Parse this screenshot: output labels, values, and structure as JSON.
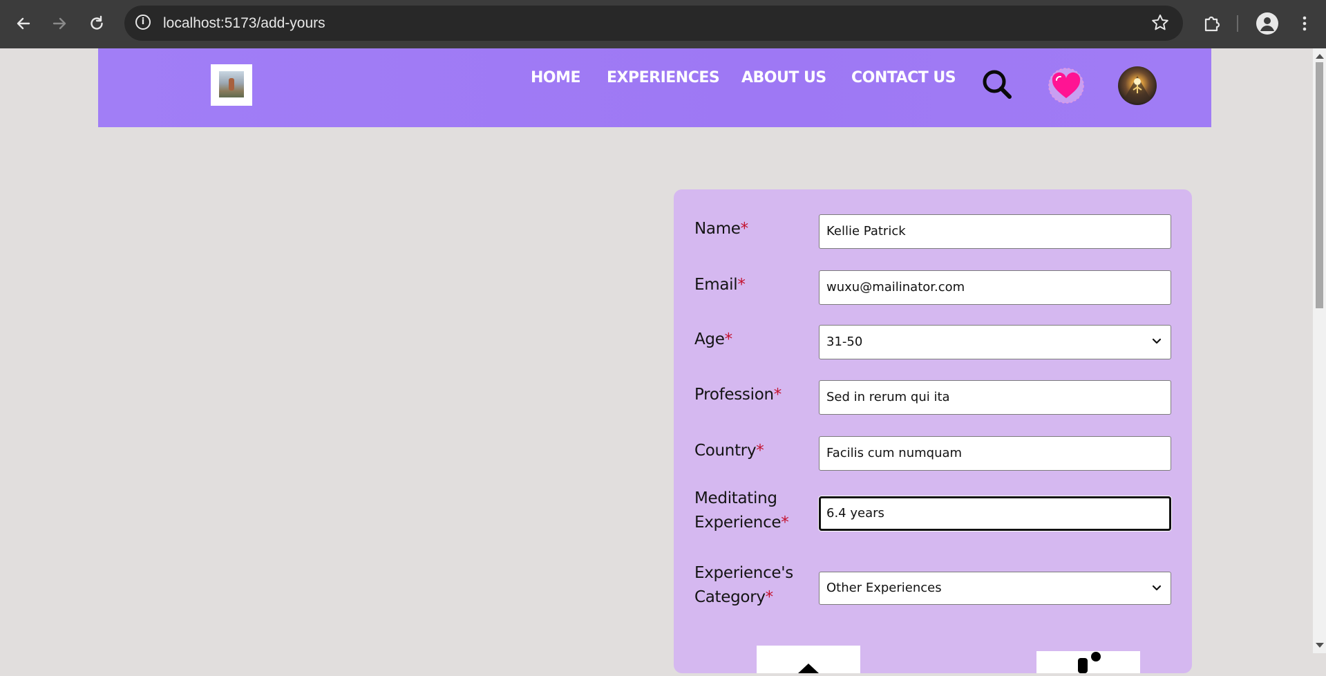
{
  "browser": {
    "url": "localhost:5173/add-yours",
    "icons": {
      "back": "arrow-left-icon",
      "forward": "arrow-right-icon",
      "reload": "reload-icon",
      "site_info": "info-icon",
      "bookmark": "star-icon",
      "extensions": "puzzle-icon",
      "profile": "person-icon",
      "menu": "kebab-menu-icon"
    }
  },
  "header": {
    "nav": {
      "home": "HOME",
      "experiences": "EXPERIENCES",
      "about": "ABOUT US",
      "contact": "CONTACT US"
    },
    "icons": {
      "search": "search-icon",
      "favorites": "heart-icon",
      "profile": "avatar"
    },
    "colors": {
      "header_bg": "#a07cf5",
      "heart": "#ff1493"
    }
  },
  "form": {
    "required_marker": "*",
    "fields": {
      "name": {
        "label": "Name",
        "value": "Kellie Patrick"
      },
      "email": {
        "label": "Email",
        "value": "wuxu@mailinator.com"
      },
      "age": {
        "label": "Age",
        "value": "31-50"
      },
      "profession": {
        "label": "Profession",
        "value": "Sed in rerum qui ita"
      },
      "country": {
        "label": "Country",
        "value": "Facilis cum numquam"
      },
      "meditating": {
        "label_line1": "Meditating",
        "label_line2": "Experience",
        "value": "6.4 years"
      },
      "category": {
        "label_line1": "Experience's",
        "label_line2": "Category",
        "value": "Other Experiences"
      }
    },
    "colors": {
      "card_bg": "#d5b8f0",
      "required": "#c4122e"
    }
  }
}
